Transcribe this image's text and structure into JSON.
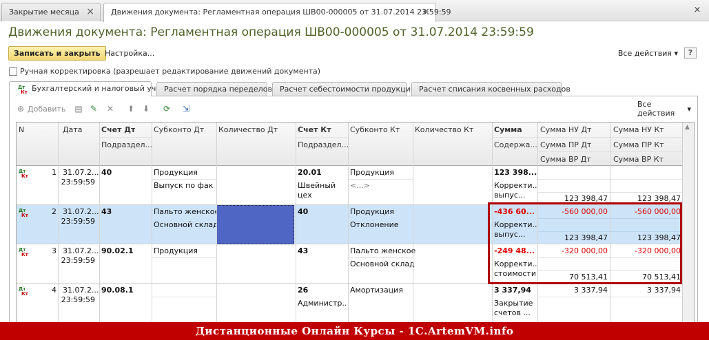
{
  "window_tabs": [
    {
      "label": "Закрытие месяца"
    },
    {
      "label": "Движения документа: Регламентная операция ШВ00-000005 от 31.07.2014 23:59:59"
    }
  ],
  "page_title": "Движения документа: Регламентная операция ШВ00-000005 от 31.07.2014 23:59:59",
  "toolbar": {
    "save_close": "Записать и закрыть",
    "settings": "Настройка...",
    "all_actions": "Все действия",
    "help": "?"
  },
  "manual_correction": {
    "label": "Ручная корректировка (разрешает редактирование движений документа)",
    "checked": false
  },
  "sub_tabs": [
    {
      "label": "Бухгалтерский и налоговый учет"
    },
    {
      "label": "Расчет порядка переделов"
    },
    {
      "label": "Расчет себестоимости продукции"
    },
    {
      "label": "Расчет списания косвенных расходов"
    }
  ],
  "dtkt": {
    "dt": "Дт",
    "kt": "Кт"
  },
  "table_toolbar": {
    "add": "Добавить",
    "all_actions": "Все действия"
  },
  "columns": {
    "n": "N",
    "date": "Дата",
    "account_dt": "Счет Дт",
    "dept_dt": "Подраздел...",
    "subconto_dt": "Субконто Дт",
    "qty_dt": "Количество Дт",
    "account_kt": "Счет Кт",
    "dept_kt": "Подраздел...",
    "subconto_kt": "Субконто Кт",
    "qty_kt": "Количество Кт",
    "sum": "Сумма",
    "content": "Содержа...",
    "nu_dt": "Сумма НУ Дт",
    "pr_dt": "Сумма ПР Дт",
    "vr_dt": "Сумма ВР Дт",
    "nu_kt": "Сумма НУ Кт",
    "pr_kt": "Сумма ПР Кт",
    "vr_kt": "Сумма ВР Кт"
  },
  "rows": [
    {
      "n": "1",
      "date": "31.07.2...",
      "time": "23:59:59",
      "account_dt": "40",
      "sub_dt1": "Продукция",
      "sub_dt2": "Выпуск по фак...",
      "account_kt": "20.01",
      "dept_kt1": "Швейный",
      "dept_kt2": "цех",
      "sub_kt1": "Продукция",
      "sub_kt2": "<...>",
      "sum": "123 398...",
      "content1": "Корректи...",
      "content2": "выпус...",
      "nu_dt": "",
      "vr_dt": "123 398,47",
      "nu_kt": "",
      "vr_kt": "123 398,47"
    },
    {
      "n": "2",
      "date": "31.07.2...",
      "time": "23:59:59",
      "account_dt": "43",
      "sub_dt1": "Пальто женское",
      "sub_dt2": "Основной склад",
      "account_kt": "40",
      "dept_kt1": "",
      "dept_kt2": "",
      "sub_kt1": "Продукция",
      "sub_kt2": "Отклонение",
      "sum": "-436 60...",
      "content1": "Корректи...",
      "content2": "выпус...",
      "nu_dt": "-560 000,00",
      "vr_dt": "123 398,47",
      "nu_kt": "-560 000,00",
      "vr_kt": "123 398,47"
    },
    {
      "n": "3",
      "date": "31.07.2...",
      "time": "23:59:59",
      "account_dt": "90.02.1",
      "sub_dt1": "Продукция",
      "sub_dt2": "",
      "account_kt": "43",
      "dept_kt1": "",
      "dept_kt2": "",
      "sub_kt1": "Пальто женское",
      "sub_kt2": "Основной склад",
      "sum": "-249 48...",
      "content1": "Корректи...",
      "content2": "стоимости",
      "nu_dt": "-320 000,00",
      "vr_dt": "70 513,41",
      "nu_kt": "-320 000,00",
      "vr_kt": "70 513,41"
    },
    {
      "n": "4",
      "date": "31.07.2...",
      "time": "23:59:59",
      "account_dt": "90.08.1",
      "sub_dt1": "",
      "sub_dt2": "",
      "account_kt": "26",
      "dept_kt1": "Администр...",
      "dept_kt2": "",
      "sub_kt1": "Амортизация",
      "sub_kt2": "",
      "sum": "3 337,94",
      "content1": "Закрытие",
      "content2": "счетов ...",
      "nu_dt": "3 337,94",
      "vr_dt": "",
      "nu_kt": "3 337,94",
      "vr_kt": ""
    }
  ],
  "footer": "Дистанционные Онлайн Курсы - 1С.ArtemVM.info",
  "colors": {
    "title": "#4f6228",
    "selected_row": "#cde3f7",
    "highlight": "#b00000",
    "negative": "#e00000",
    "footer_bg": "#c00000"
  }
}
